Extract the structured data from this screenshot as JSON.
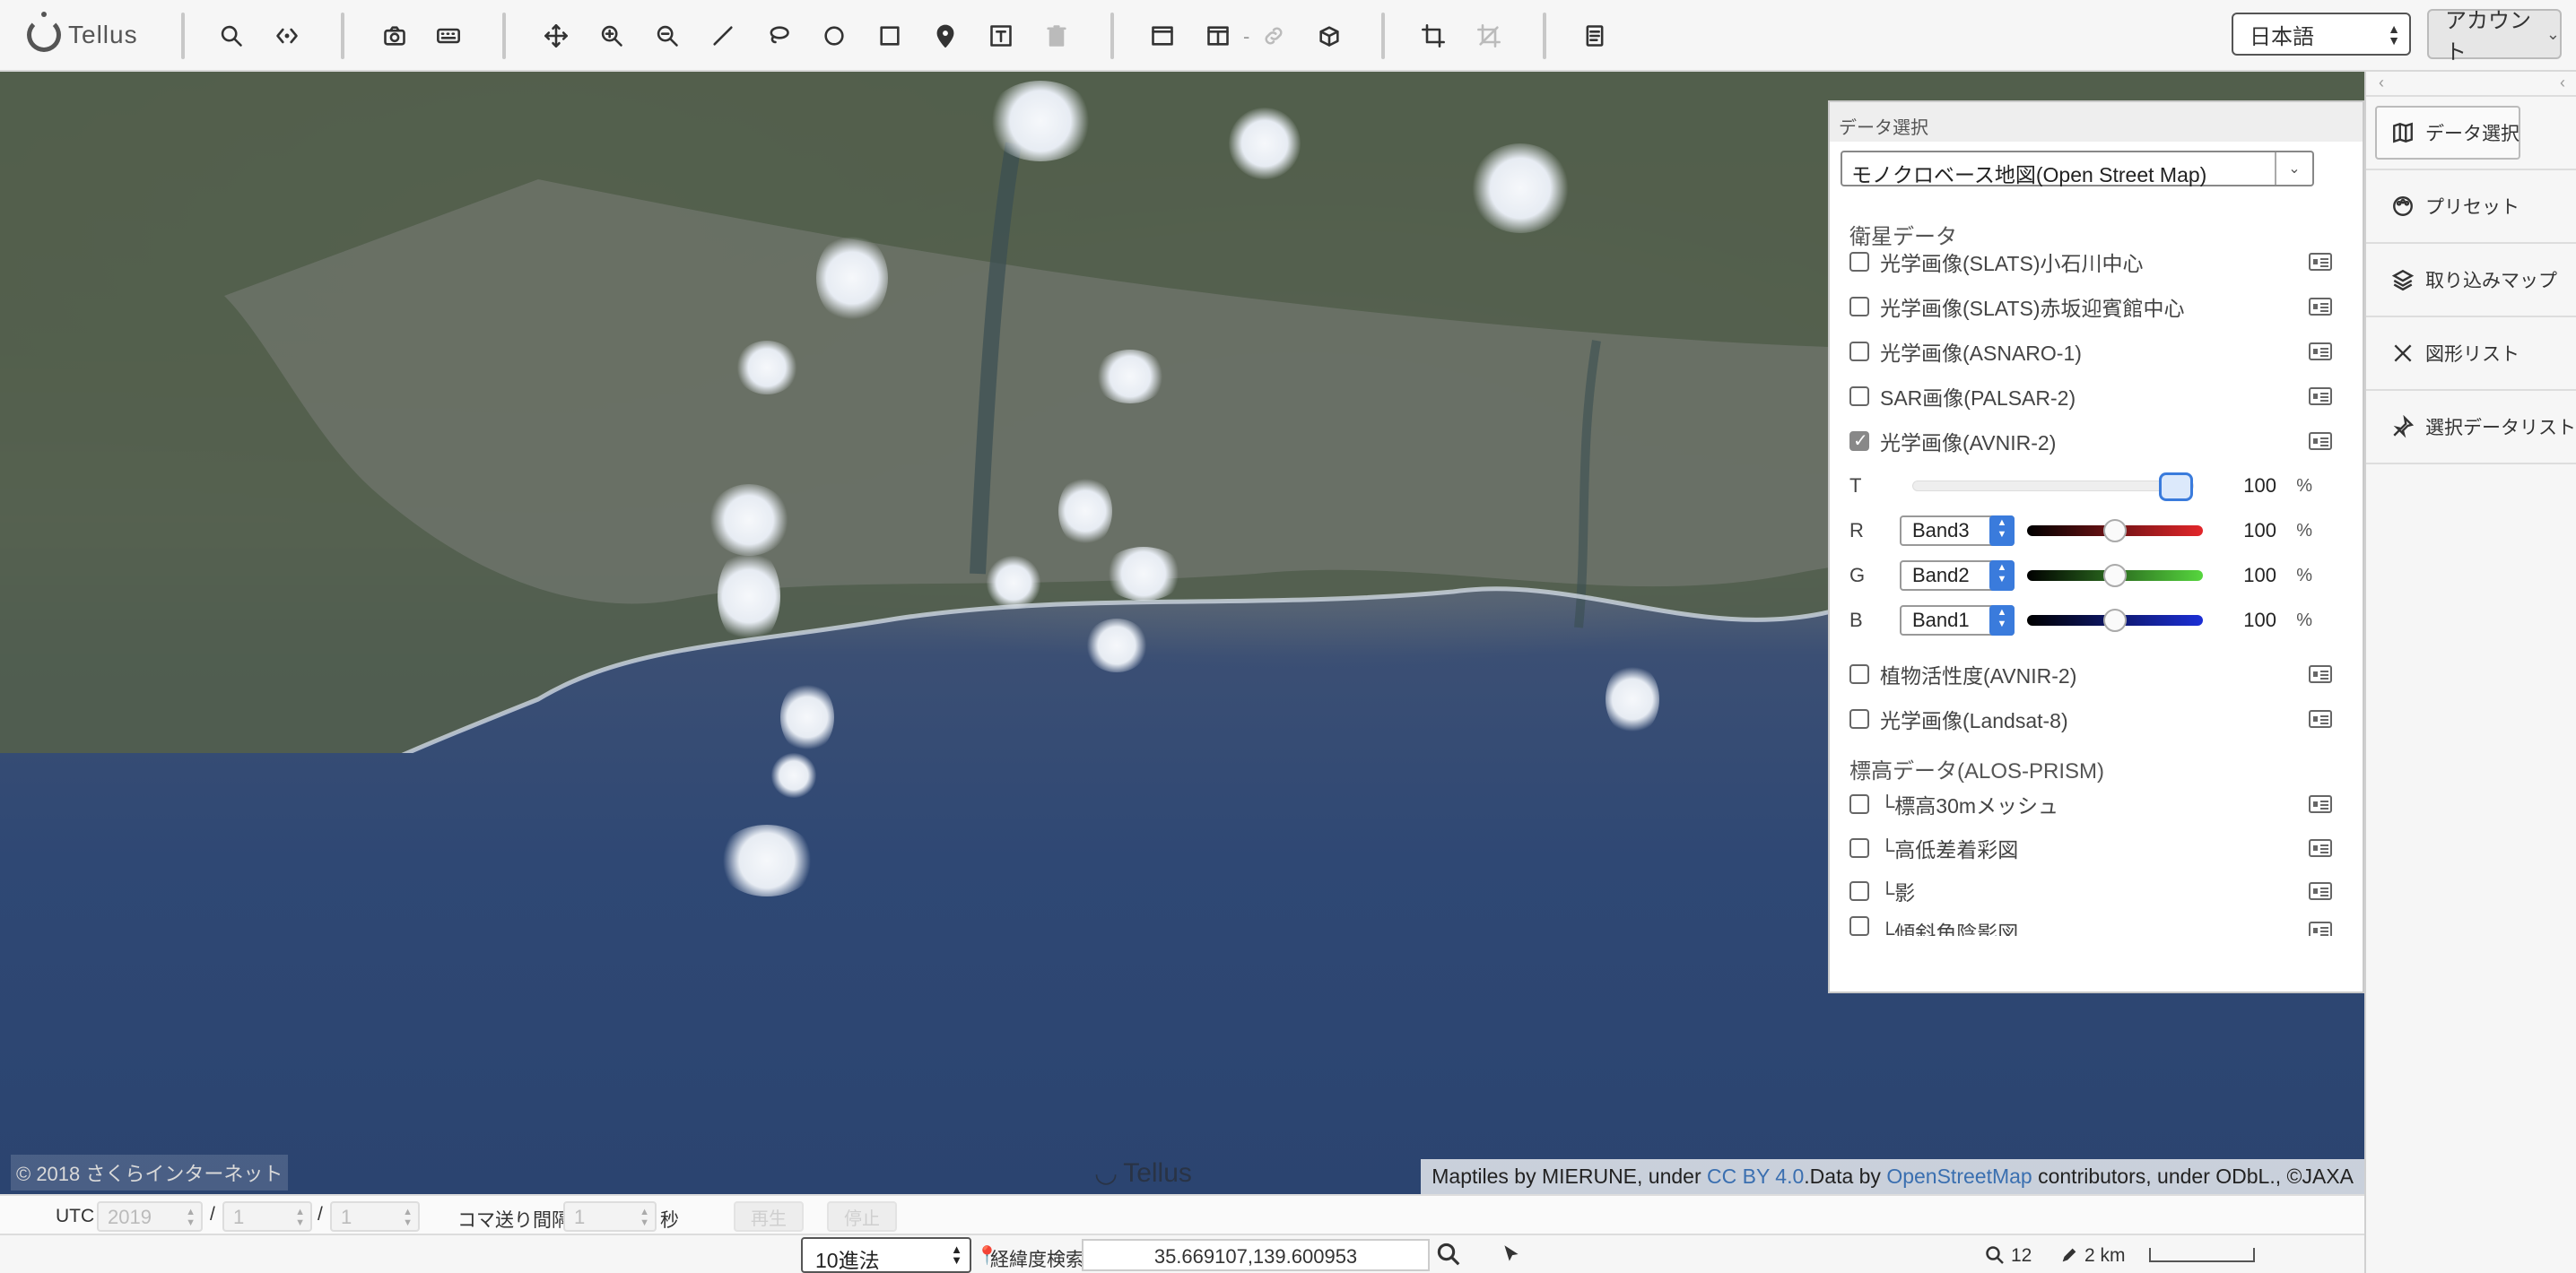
{
  "app": {
    "logo_text": "Tellus"
  },
  "toolbar": {
    "language": "日本語",
    "account_label": "アカウント",
    "tools": [
      "search-icon",
      "code-icon",
      "camera-icon",
      "keyboard-icon",
      "move-icon",
      "zoom-in-icon",
      "zoom-out-icon",
      "line-icon",
      "lasso-icon",
      "circle-icon",
      "rectangle-icon",
      "pin-icon",
      "text-icon",
      "trash-icon",
      "window-icon",
      "split-window-icon",
      "link-icon",
      "cube-icon",
      "crop-icon",
      "crop-off-icon",
      "document-icon"
    ]
  },
  "map": {
    "copyright": "© 2018 さくらインターネット",
    "watermark": "Tellus",
    "attribution": {
      "prefix": "Maptiles by MIERUNE, under ",
      "cc": "CC BY 4.0",
      "mid": ".Data by ",
      "osm": "OpenStreetMap",
      "mid2": " contributors, under ODbL., ",
      "suffix": "©JAXA"
    }
  },
  "data_panel": {
    "title": "データ選択",
    "base_map": "モノクロベース地図(Open Street Map)",
    "satellite_group": "衛星データ",
    "satellite_layers": [
      {
        "label": "光学画像(SLATS)小石川中心",
        "checked": false
      },
      {
        "label": "光学画像(SLATS)赤坂迎賓館中心",
        "checked": false
      },
      {
        "label": "光学画像(ASNARO-1)",
        "checked": false
      },
      {
        "label": "SAR画像(PALSAR-2)",
        "checked": false
      },
      {
        "label": "光学画像(AVNIR-2)",
        "checked": true
      }
    ],
    "avnir_controls": {
      "transparency": {
        "label": "T",
        "value": "100",
        "unit": "%",
        "level": 1.0
      },
      "channels": [
        {
          "label": "R",
          "band": "Band3",
          "value": "100",
          "unit": "%",
          "level": 0.5,
          "color": "#e3262a"
        },
        {
          "label": "G",
          "band": "Band2",
          "value": "100",
          "unit": "%",
          "level": 0.5,
          "color": "#56d63e"
        },
        {
          "label": "B",
          "band": "Band1",
          "value": "100",
          "unit": "%",
          "level": 0.5,
          "color": "#1c2fd6"
        }
      ]
    },
    "more_layers": [
      {
        "label": "植物活性度(AVNIR-2)",
        "checked": false
      },
      {
        "label": "光学画像(Landsat-8)",
        "checked": false
      }
    ],
    "elevation_group": "標高データ(ALOS-PRISM)",
    "elevation_layers": [
      {
        "label": "└標高30mメッシュ",
        "checked": false
      },
      {
        "label": "└高低差着彩図",
        "checked": false
      },
      {
        "label": "└影",
        "checked": false
      },
      {
        "label": "└傾斜角陰影図",
        "checked": false
      }
    ]
  },
  "sidebar": {
    "items": [
      {
        "label": "データ選択",
        "icon": "map-icon",
        "active": true
      },
      {
        "label": "プリセット",
        "icon": "palette-icon",
        "active": false
      },
      {
        "label": "取り込みマップ",
        "icon": "layers-icon",
        "active": false
      },
      {
        "label": "図形リスト",
        "icon": "tools-icon",
        "active": false
      },
      {
        "label": "選択データリスト",
        "icon": "pin-list-icon",
        "active": false
      }
    ]
  },
  "timebar": {
    "utc_label": "UTC",
    "year": "2019",
    "month": "1",
    "day": "1",
    "sep": "/",
    "frame_interval_label": "コマ送り間隔",
    "interval": "1",
    "seconds_label": "秒",
    "play_label": "再生",
    "stop_label": "停止"
  },
  "statusbar": {
    "radix": "10進法",
    "coord_search_label": "経緯度検索",
    "coordinates": "35.669107,139.600953",
    "zoom_level": "12",
    "scale_label": "2 km"
  }
}
